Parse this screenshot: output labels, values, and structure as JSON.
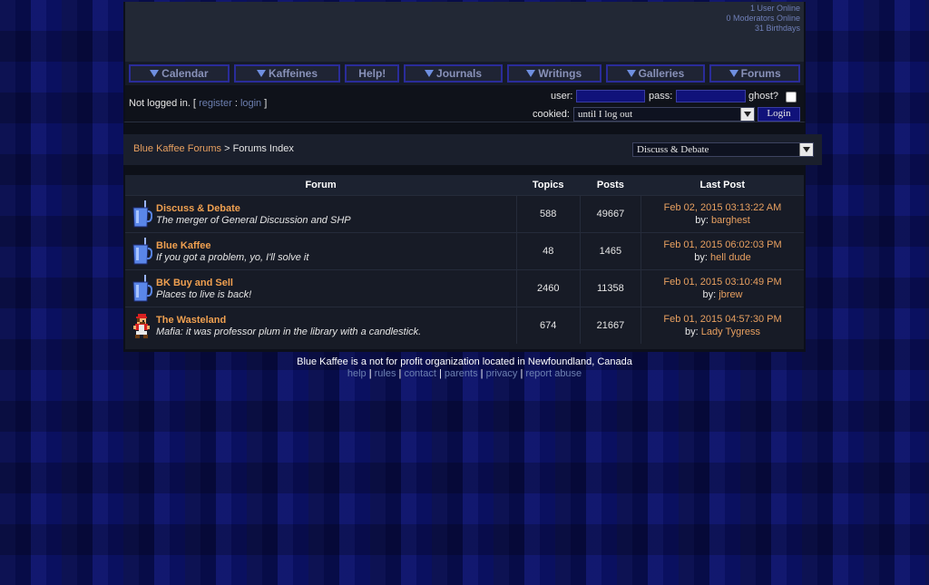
{
  "header": {
    "users_online": "1 User Online",
    "moderators_online": "0 Moderators Online",
    "birthdays": "31 Birthdays"
  },
  "nav": [
    {
      "label": "Calendar",
      "dropdown": true
    },
    {
      "label": "Kaffeines",
      "dropdown": true
    },
    {
      "label": "Help!",
      "dropdown": false
    },
    {
      "label": "Journals",
      "dropdown": true
    },
    {
      "label": "Writings",
      "dropdown": true
    },
    {
      "label": "Galleries",
      "dropdown": true
    },
    {
      "label": "Forums",
      "dropdown": true
    }
  ],
  "login": {
    "status_prefix": "Not logged in. [",
    "register": "register",
    "sep": ":",
    "login_link": "login",
    "status_suffix": "]",
    "user_label": "user:",
    "pass_label": "pass:",
    "ghost_label": "ghost?",
    "cookied_label": "cookied:",
    "cookied_value": "until I log out",
    "button": "Login"
  },
  "breadcrumb": {
    "root": "Blue Kaffee Forums",
    "sep": ">",
    "current": "Forums Index",
    "jump_value": "Discuss & Debate"
  },
  "table": {
    "headers": {
      "forum": "Forum",
      "topics": "Topics",
      "posts": "Posts",
      "last_post": "Last Post"
    },
    "rows": [
      {
        "name": "Discuss & Debate",
        "desc": "The merger of General Discussion and SHP",
        "topics": "588",
        "posts": "49667",
        "date": "Feb 02, 2015 03:13:22 AM",
        "by": "by:",
        "user": "barghest",
        "icon": "coffee-mug-icon"
      },
      {
        "name": "Blue Kaffee",
        "desc": "If you got a problem, yo, I'll solve it",
        "topics": "48",
        "posts": "1465",
        "date": "Feb 01, 2015 06:02:03 PM",
        "by": "by:",
        "user": "hell dude",
        "icon": "coffee-mug-icon"
      },
      {
        "name": "BK Buy and Sell",
        "desc": "Places to live is back!",
        "topics": "2460",
        "posts": "11358",
        "date": "Feb 01, 2015 03:10:49 PM",
        "by": "by:",
        "user": "jbrew",
        "icon": "coffee-mug-icon"
      },
      {
        "name": "The Wasteland",
        "desc": "Mafia: it was professor plum in the library with a candlestick.",
        "topics": "674",
        "posts": "21667",
        "date": "Feb 01, 2015 04:57:30 PM",
        "by": "by:",
        "user": "Lady Tygress",
        "icon": "pixel-mario-icon"
      }
    ]
  },
  "footer": {
    "tagline": "Blue Kaffee is a not for profit organization located in Newfoundland, Canada",
    "links": [
      "help",
      "rules",
      "contact",
      "parents",
      "privacy",
      "report abuse"
    ],
    "sep": "|"
  }
}
